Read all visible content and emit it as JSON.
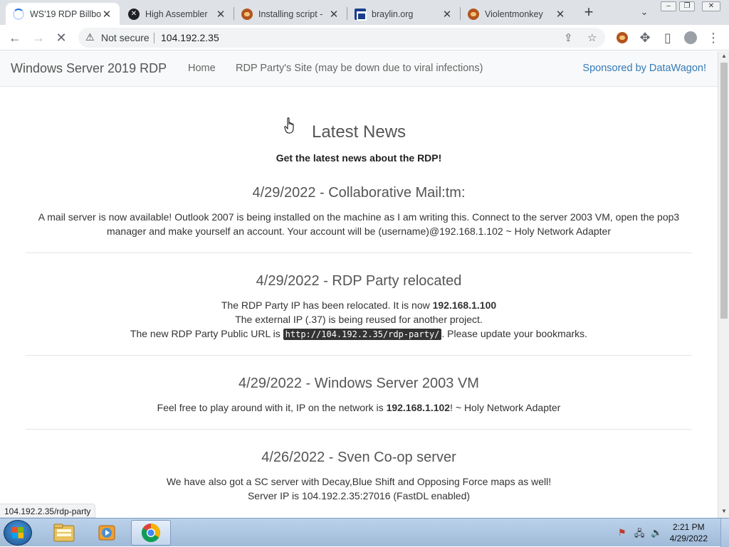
{
  "browser": {
    "tabs": [
      {
        "title": "WS'19 RDP Billbo",
        "icon": "loading-spinner-icon",
        "active": true
      },
      {
        "title": "High Assembler",
        "icon": "high-assembler-icon",
        "active": false
      },
      {
        "title": "Installing script - ",
        "icon": "violentmonkey-icon",
        "active": false
      },
      {
        "title": "braylin.org",
        "icon": "braylin-icon",
        "active": false
      },
      {
        "title": "Violentmonkey",
        "icon": "violentmonkey-icon",
        "active": false
      }
    ],
    "new_tab_label": "+",
    "omnibox": {
      "security_label": "Not secure",
      "url": "104.192.2.35"
    },
    "status_url": "104.192.2.35/rdp-party"
  },
  "site": {
    "brand": "Windows Server 2019 RDP",
    "nav": {
      "home": "Home",
      "party": "RDP Party's Site (may be down due to viral infections)"
    },
    "sponsor_text": "Sponsored by DataWagon",
    "sponsor_bang": "!",
    "heading": "Latest News",
    "subheading": "Get the latest news about the RDP!",
    "posts": [
      {
        "title": "4/29/2022 - Collaborative Mail:tm:",
        "lines": [
          "A mail server is now available! Outlook 2007 is being installed on the machine as I am writing this. Connect to the server 2003 VM, open the pop3",
          "manager and make yourself an account. Your account will be (username)@192.168.1.102 ~ Holy Network Adapter"
        ]
      },
      {
        "title": "4/29/2022 - RDP Party relocated",
        "line1_prefix": "The RDP Party IP has been relocated. It is now ",
        "line1_bold": "192.168.1.100",
        "line2": "The external IP (.37) is being reused for another project.",
        "line3_prefix": "The new RDP Party Public URL is ",
        "line3_code": "http://104.192.2.35/rdp-party/",
        "line3_suffix": ". Please update your bookmarks."
      },
      {
        "title": "4/29/2022 - Windows Server 2003 VM",
        "line_prefix": "Feel free to play around with it, IP on the network is ",
        "line_bold": "192.168.1.102",
        "line_suffix": "! ~ Holy Network Adapter"
      },
      {
        "title": "4/26/2022 - Sven Co-op server",
        "lines": [
          "We have also got a SC server with Decay,Blue Shift and Opposing Force maps as well!",
          "Server IP is 104.192.2.35:27016 (FastDL enabled)"
        ]
      }
    ]
  },
  "taskbar": {
    "clock_time": "2:21 PM",
    "clock_date": "4/29/2022",
    "apps": [
      "explorer-icon",
      "media-player-icon",
      "chrome-icon"
    ]
  },
  "colors": {
    "link": "#337ab7",
    "navbar_bg": "#f8f9fa",
    "tabstrip_bg": "#dee1e6"
  }
}
